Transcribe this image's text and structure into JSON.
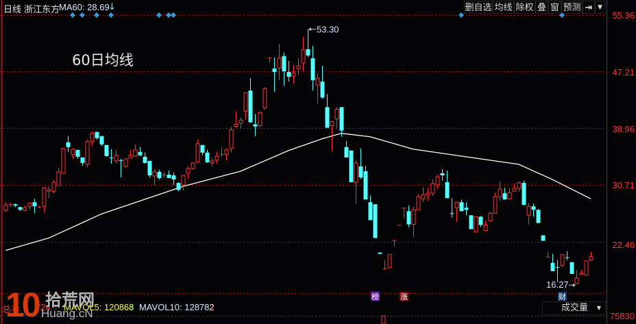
{
  "header": {
    "period": "日线",
    "stock_name": "浙江东方",
    "ma_label": "MA60: 28.69",
    "ma_trend_icon": "arrow-down-icon"
  },
  "toolbar": {
    "buttons": [
      "删自选",
      "均线",
      "除权",
      "叠",
      "窗",
      "预测"
    ],
    "exit_icon": "exit-arrow-icon",
    "menu_icon": "dropdown-icon"
  },
  "overlay_text": "60日均线",
  "volume": {
    "total_label": "总手",
    "total_value_visible": "724",
    "mavol5": "MAVOL5: 120868",
    "mavol10": "MAVOL10: 128782",
    "indicator_select": "成交量",
    "axis_top": "75830"
  },
  "watermark": {
    "text": "10 拾荒网 Huang.cN"
  },
  "colors": {
    "up": "#ff3333",
    "down": "#54ffff",
    "ma60": "#ffffff",
    "grid": "#b01010",
    "axis_text": "#ff3333",
    "marker": "#3a9ad9"
  },
  "chart_data": {
    "type": "candlestick",
    "title": "",
    "y_ticks": [
      55.36,
      47.21,
      38.96,
      30.71,
      22.46
    ],
    "ylim": [
      15.5,
      55.36
    ],
    "grid": true,
    "annotations": [
      {
        "label": "53.30",
        "type": "high",
        "index": 63,
        "value": 53.3
      },
      {
        "label": "16.27",
        "type": "low",
        "index": 119,
        "value": 16.27
      }
    ],
    "event_markers": [
      {
        "label": "榜",
        "index": 77,
        "color": "#6a1fb0"
      },
      {
        "label": "涨",
        "index": 83,
        "color": "#8a0a0a"
      },
      {
        "label": "财",
        "index": 116,
        "color": "#1a3a6a"
      }
    ],
    "info_marker_indices": [
      14,
      16,
      19,
      22,
      32,
      34,
      35,
      95,
      116
    ],
    "ma60": [
      [
        0,
        21.2
      ],
      [
        9,
        23.0
      ],
      [
        20,
        26.5
      ],
      [
        37,
        30.5
      ],
      [
        49,
        32.7
      ],
      [
        59,
        35.7
      ],
      [
        66,
        37.4
      ],
      [
        70,
        38.2
      ],
      [
        76,
        37.7
      ],
      [
        85,
        35.9
      ],
      [
        99,
        34.5
      ],
      [
        107,
        33.7
      ],
      [
        114,
        31.5
      ],
      [
        122,
        28.7
      ]
    ],
    "ohlc": [
      [
        27.0,
        28.2,
        26.8,
        27.8
      ],
      [
        27.8,
        28.1,
        27.5,
        27.9
      ],
      [
        27.9,
        28.0,
        27.5,
        27.7
      ],
      [
        27.5,
        27.5,
        26.9,
        27.1
      ],
      [
        27.0,
        27.7,
        26.9,
        27.4
      ],
      [
        27.6,
        28.1,
        27.1,
        28.1
      ],
      [
        28.2,
        28.7,
        26.6,
        27.6
      ],
      [
        27.4,
        27.7,
        27.4,
        27.5
      ],
      [
        27.6,
        30.4,
        26.7,
        30.3
      ],
      [
        29.8,
        30.5,
        28.8,
        30.0
      ],
      [
        29.8,
        31.4,
        29.5,
        31.1
      ],
      [
        30.6,
        33.2,
        30.6,
        32.6
      ],
      [
        32.4,
        36.0,
        32.4,
        36.0
      ],
      [
        36.9,
        37.8,
        35.5,
        36.2
      ],
      [
        35.1,
        36.1,
        34.5,
        35.9
      ],
      [
        35.8,
        35.8,
        34.5,
        34.8
      ],
      [
        34.7,
        34.7,
        33.5,
        33.9
      ],
      [
        33.7,
        37.3,
        33.3,
        37.0
      ],
      [
        37.0,
        38.5,
        36.4,
        38.2
      ],
      [
        38.4,
        38.4,
        37.3,
        37.5
      ],
      [
        37.8,
        37.8,
        36.4,
        36.6
      ],
      [
        36.5,
        36.5,
        34.8,
        34.9
      ],
      [
        34.7,
        35.9,
        33.8,
        34.6
      ],
      [
        34.2,
        35.8,
        33.9,
        35.0
      ],
      [
        34.3,
        34.5,
        31.8,
        34.2
      ],
      [
        33.4,
        34.5,
        33.2,
        34.5
      ],
      [
        34.6,
        35.8,
        34.6,
        35.0
      ],
      [
        34.9,
        36.6,
        34.8,
        35.8
      ],
      [
        35.5,
        36.2,
        34.9,
        35.0
      ],
      [
        34.8,
        35.4,
        33.8,
        33.9
      ],
      [
        34.2,
        34.2,
        31.8,
        32.1
      ],
      [
        32.0,
        33.0,
        30.7,
        32.6
      ],
      [
        32.6,
        32.9,
        31.5,
        31.7
      ],
      [
        32.1,
        32.6,
        31.7,
        32.2
      ],
      [
        32.2,
        32.8,
        31.7,
        31.7
      ],
      [
        32.1,
        32.5,
        30.7,
        31.5
      ],
      [
        31.0,
        31.1,
        29.8,
        30.0
      ],
      [
        30.7,
        32.1,
        29.9,
        32.1
      ],
      [
        32.4,
        33.4,
        31.6,
        33.1
      ],
      [
        33.1,
        34.0,
        32.9,
        33.9
      ],
      [
        34.0,
        37.3,
        33.9,
        36.7
      ],
      [
        36.5,
        36.5,
        35.0,
        35.4
      ],
      [
        35.4,
        35.8,
        33.9,
        34.0
      ],
      [
        33.9,
        34.6,
        33.4,
        34.2
      ],
      [
        34.3,
        35.5,
        33.8,
        34.9
      ],
      [
        35.1,
        36.2,
        34.8,
        35.2
      ],
      [
        35.1,
        36.0,
        34.3,
        35.8
      ],
      [
        36.0,
        39.1,
        35.4,
        38.7
      ],
      [
        39.2,
        41.4,
        39.0,
        39.5
      ],
      [
        39.7,
        40.5,
        38.9,
        40.1
      ],
      [
        41.4,
        44.1,
        40.2,
        44.1
      ],
      [
        44.4,
        46.2,
        39.7,
        39.8
      ],
      [
        39.5,
        41.0,
        37.8,
        39.2
      ],
      [
        39.3,
        41.4,
        39.1,
        41.2
      ],
      [
        41.9,
        44.9,
        41.6,
        44.7
      ],
      [
        49.2,
        49.2,
        48.5,
        49.2
      ],
      [
        47.6,
        49.2,
        44.2,
        47.1
      ],
      [
        47.7,
        51.2,
        45.9,
        49.1
      ],
      [
        49.4,
        49.9,
        45.1,
        47.2
      ],
      [
        47.1,
        48.7,
        45.7,
        46.4
      ],
      [
        46.5,
        48.1,
        45.4,
        46.9
      ],
      [
        47.6,
        49.1,
        46.7,
        48.0
      ],
      [
        48.4,
        52.2,
        47.2,
        50.3
      ],
      [
        50.4,
        53.3,
        49.3,
        49.5
      ],
      [
        49.1,
        50.9,
        44.4,
        45.9
      ],
      [
        45.2,
        46.9,
        42.5,
        46.2
      ],
      [
        45.7,
        48.0,
        43.2,
        43.4
      ],
      [
        42.0,
        43.9,
        39.0,
        39.0
      ],
      [
        39.3,
        40.0,
        35.6,
        39.9
      ],
      [
        40.3,
        42.0,
        38.9,
        41.7
      ],
      [
        42.0,
        42.0,
        37.7,
        38.6
      ],
      [
        36.2,
        37.1,
        34.7,
        34.7
      ],
      [
        35.7,
        35.7,
        31.1,
        31.1
      ],
      [
        31.1,
        34.3,
        28.0,
        33.9
      ],
      [
        33.4,
        36.0,
        31.6,
        31.8
      ],
      [
        32.7,
        33.5,
        28.6,
        28.6
      ],
      [
        28.2,
        29.2,
        25.6,
        25.6
      ],
      [
        27.9,
        27.9,
        23.0,
        23.0
      ],
      [
        20.9,
        20.9,
        20.7,
        20.7
      ],
      [
        18.6,
        19.8,
        18.6,
        18.6
      ],
      [
        18.7,
        20.6,
        18.6,
        20.6
      ],
      [
        22.7,
        22.7,
        21.8,
        22.7
      ],
      [
        24.9,
        24.9,
        24.9,
        24.9
      ],
      [
        27.4,
        27.4,
        25.9,
        27.4
      ],
      [
        26.9,
        27.7,
        24.6,
        25.0
      ],
      [
        25.0,
        27.5,
        23.2,
        27.1
      ],
      [
        27.1,
        29.4,
        27.1,
        29.0
      ],
      [
        28.7,
        30.4,
        28.2,
        29.3
      ],
      [
        29.2,
        30.3,
        28.4,
        29.5
      ],
      [
        29.5,
        31.5,
        29.1,
        30.9
      ],
      [
        30.7,
        32.2,
        30.1,
        31.9
      ],
      [
        32.4,
        33.0,
        31.3,
        32.1
      ],
      [
        31.1,
        32.8,
        28.8,
        28.8
      ],
      [
        26.6,
        28.8,
        26.0,
        26.5
      ],
      [
        27.4,
        28.3,
        25.3,
        28.2
      ],
      [
        28.2,
        28.6,
        26.9,
        26.9
      ],
      [
        27.4,
        28.2,
        26.3,
        27.1
      ],
      [
        26.3,
        26.3,
        24.3,
        24.3
      ],
      [
        23.9,
        26.1,
        23.9,
        26.1
      ],
      [
        26.1,
        26.2,
        24.6,
        24.9
      ],
      [
        24.1,
        25.5,
        24.1,
        24.9
      ],
      [
        25.5,
        26.8,
        25.5,
        26.6
      ],
      [
        26.6,
        29.6,
        26.6,
        29.0
      ],
      [
        29.0,
        31.2,
        28.4,
        30.1
      ],
      [
        29.5,
        30.3,
        28.6,
        28.6
      ],
      [
        28.7,
        30.3,
        28.6,
        29.6
      ],
      [
        29.8,
        30.9,
        29.8,
        30.2
      ],
      [
        30.2,
        31.2,
        29.7,
        31.0
      ],
      [
        31.0,
        31.3,
        27.8,
        27.8
      ],
      [
        26.3,
        28.1,
        25.0,
        27.6
      ],
      [
        27.6,
        28.0,
        26.1,
        27.1
      ],
      [
        27.1,
        27.2,
        25.1,
        25.2
      ],
      [
        23.4,
        23.4,
        22.6,
        22.6
      ],
      [
        20.3,
        21.0,
        20.3,
        20.3
      ],
      [
        19.4,
        20.7,
        18.2,
        18.2
      ],
      [
        18.8,
        19.8,
        16.6,
        18.7
      ],
      [
        19.0,
        20.6,
        18.8,
        20.6
      ],
      [
        20.2,
        21.1,
        19.8,
        20.1
      ],
      [
        19.5,
        19.5,
        17.8,
        17.8
      ],
      [
        16.4,
        18.4,
        16.27,
        17.2
      ],
      [
        17.7,
        18.4,
        17.7,
        17.9
      ],
      [
        17.6,
        19.7,
        17.6,
        19.7
      ],
      [
        19.8,
        21.0,
        19.7,
        20.3
      ]
    ]
  }
}
